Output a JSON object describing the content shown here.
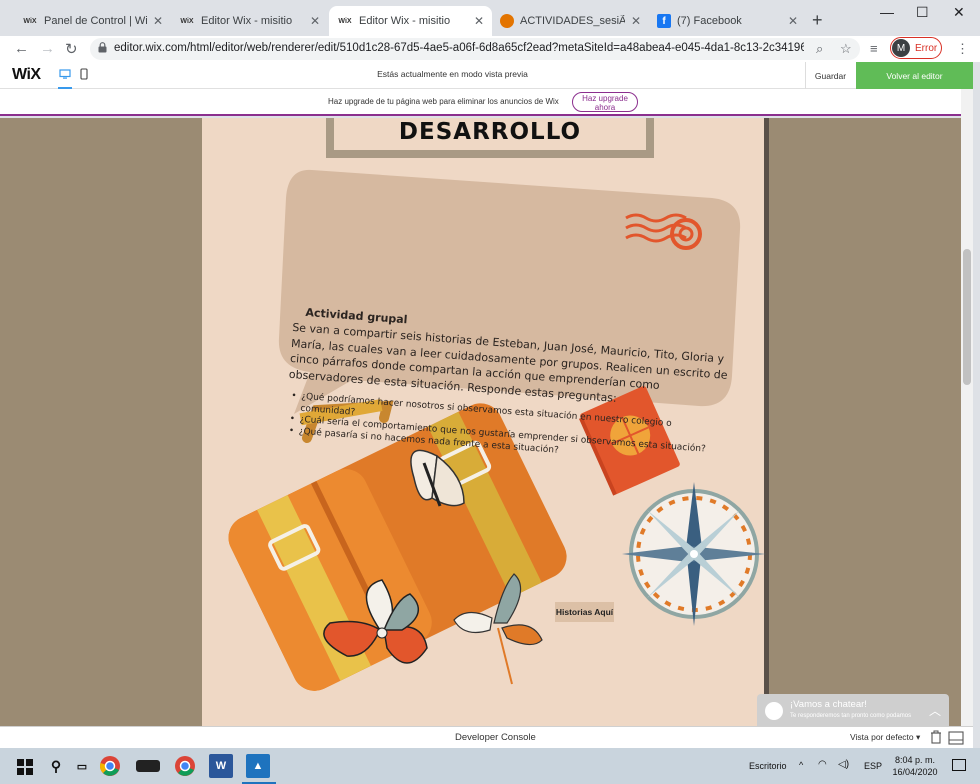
{
  "browser": {
    "tabs": [
      {
        "icon": "wix-favicon",
        "label": "Panel de Control | Wix.com",
        "active": false
      },
      {
        "icon": "wix-favicon",
        "label": "Editor Wix - misitio",
        "active": false
      },
      {
        "icon": "wix-favicon",
        "label": "Editor Wix - misitio",
        "active": true
      },
      {
        "icon": "document-favicon",
        "label": "ACTIVIDADES_sesiÃ³n_4.pc",
        "active": false
      },
      {
        "icon": "facebook-favicon",
        "label": "(7) Facebook",
        "active": false
      }
    ],
    "url": "editor.wix.com/html/editor/web/renderer/edit/510d1c28-67d5-4ae5-a06f-6d8a65cf2ead?metaSiteId=a48abea4-e045-4da1-8c13-2c34196f25ad...",
    "profile_initial": "M",
    "profile_status": "Error",
    "error_color": "#d93025"
  },
  "wix": {
    "logo": "WiX",
    "preview_message": "Estás actualmente en modo vista previa",
    "save_label": "Guardar",
    "back_label": "Volver al editor",
    "back_color": "#60bc57"
  },
  "upgrade": {
    "text": "Haz upgrade de tu página web para eliminar los anuncios de Wix",
    "button_line1": "Haz upgrade",
    "button_line2": "ahora",
    "accent": "#8b2f8e"
  },
  "site": {
    "title": "DESARROLLO",
    "bubble_title": "Actividad grupal",
    "bubble_paragraph": "Se van a compartir seis historias de Esteban, Juan José, Mauricio, Tito, Gloria y María, las cuales van a leer cuidadosamente por grupos. Realicen un  escrito  de cinco párrafos donde compartan la acción que emprenderían como observadores de esta situación. Responde estas preguntas:",
    "questions": [
      "¿Qué podríamos hacer nosotros si observamos esta situación en nuestro colegio o comunidad?",
      "¿Cuál sería el comportamiento que nos gustaría emprender si observamos esta situación?",
      "¿Qué pasaría si no hacemos nada frente a esta situación?"
    ],
    "historias_button": "Historias Aquí"
  },
  "chat": {
    "title": "¡Vamos a chatear!",
    "subtitle": "Te responderemos tan pronto como podamos"
  },
  "devconsole": {
    "title": "Developer Console",
    "view": "Vista por defecto"
  },
  "taskbar": {
    "desktop": "Escritorio",
    "language": "ESP",
    "time": "8:04 p. m.",
    "date": "16/04/2020"
  }
}
